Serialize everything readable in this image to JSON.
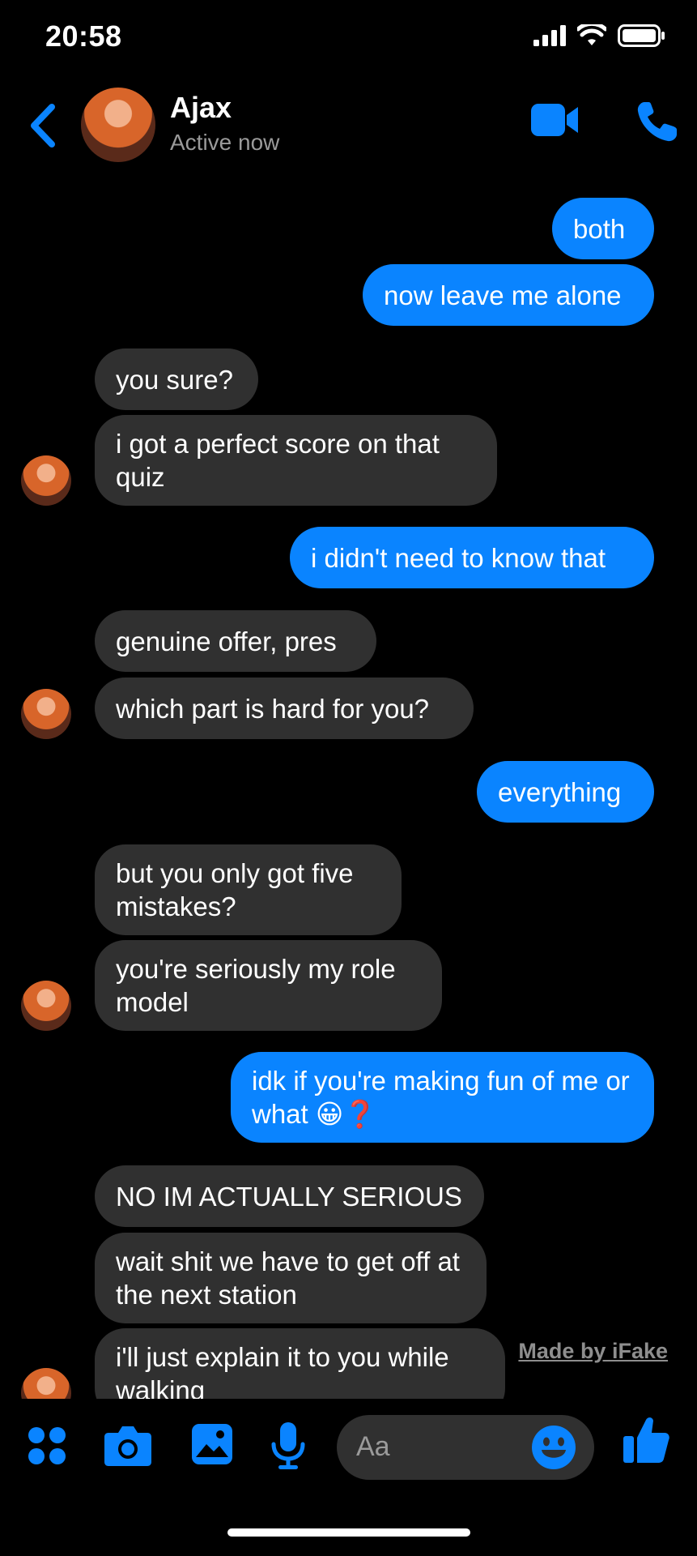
{
  "status_bar": {
    "time": "20:58"
  },
  "header": {
    "name": "Ajax",
    "status": "Active now"
  },
  "colors": {
    "accent": "#0a84ff",
    "incoming_bubble": "#303030",
    "background": "#000000"
  },
  "messages": [
    {
      "from": "me",
      "text": "both"
    },
    {
      "from": "me",
      "text": "now leave me alone"
    },
    {
      "from": "them",
      "text": "you sure?"
    },
    {
      "from": "them",
      "text": "i got a perfect score on that quiz"
    },
    {
      "from": "me",
      "text": "i didn't need to know that"
    },
    {
      "from": "them",
      "text": "genuine offer, pres"
    },
    {
      "from": "them",
      "text": "which part is hard for you?"
    },
    {
      "from": "me",
      "text": "everything"
    },
    {
      "from": "them",
      "text": "but you only got five mistakes?"
    },
    {
      "from": "them",
      "text": "you're seriously my role model"
    },
    {
      "from": "me",
      "text": "idk if you're making fun of me or what 😀❓"
    },
    {
      "from": "them",
      "text": "NO IM ACTUALLY SERIOUS"
    },
    {
      "from": "them",
      "text": "wait shit we have to get off at the next station"
    },
    {
      "from": "them",
      "text": "i'll just explain it to you while walking"
    }
  ],
  "watermark": "Made by iFake",
  "composer": {
    "placeholder": "Aa",
    "icons": [
      "apps-icon",
      "camera-icon",
      "photo-icon",
      "microphone-icon",
      "emoji-icon",
      "thumbs-up-icon"
    ]
  }
}
